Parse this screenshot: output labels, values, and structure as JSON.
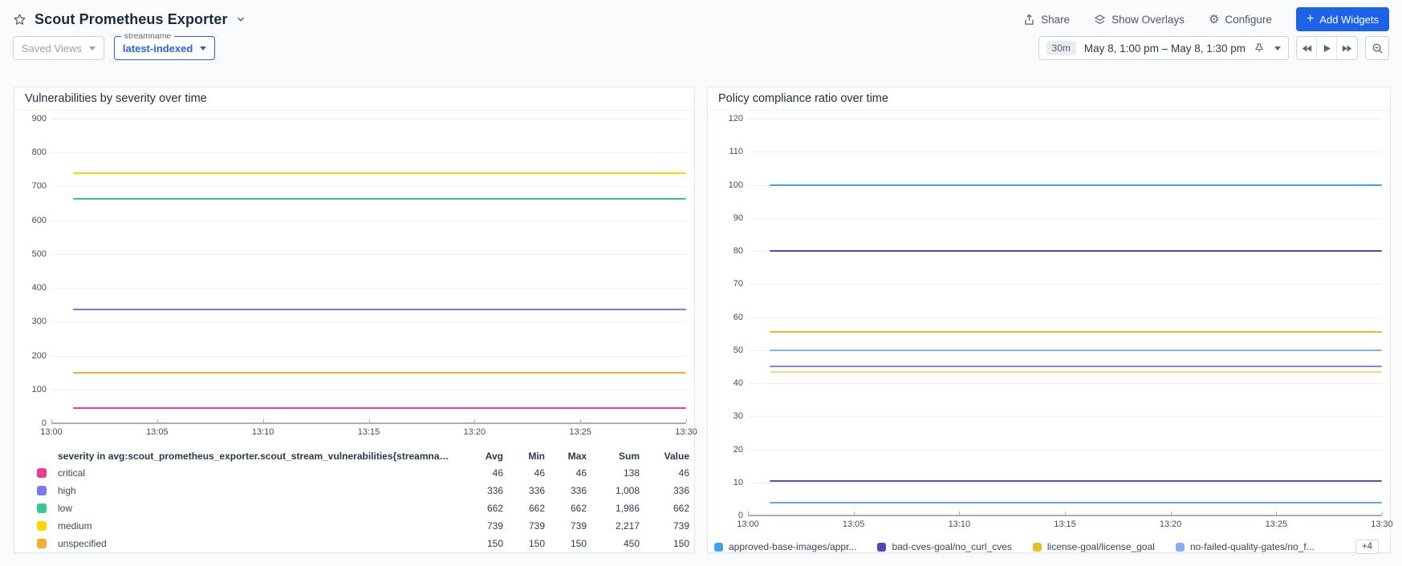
{
  "header": {
    "title": "Scout Prometheus Exporter",
    "share": "Share",
    "show_overlays": "Show Overlays",
    "configure": "Configure",
    "add_widgets": "Add Widgets",
    "accent_color": "#1d63ea"
  },
  "toolbar": {
    "saved_views": "Saved Views",
    "stream_label": "streamname",
    "stream_value": "latest-indexed",
    "duration_badge": "30m",
    "time_range": "May 8, 1:00 pm – May 8, 1:30 pm"
  },
  "chart_data": [
    {
      "type": "line",
      "title": "Vulnerabilities by severity over time",
      "x_ticks": [
        "13:00",
        "13:05",
        "13:10",
        "13:15",
        "13:20",
        "13:25",
        "13:30"
      ],
      "ylim": [
        0,
        900
      ],
      "ytick_step": 100,
      "grid": true,
      "legend_position": "bottom-table",
      "series": [
        {
          "name": "critical",
          "color": "#ee3d8b",
          "value": 46
        },
        {
          "name": "high",
          "color": "#7a77e9",
          "value": 336
        },
        {
          "name": "low",
          "color": "#33c79c",
          "value": 662
        },
        {
          "name": "medium",
          "color": "#ffd600",
          "value": 739
        },
        {
          "name": "unspecified",
          "color": "#f7ad33",
          "value": 150
        }
      ],
      "legend_table": {
        "header": "severity in avg:scout_prometheus_exporter.scout_stream_vulnerabilities{streamname:late...",
        "columns": [
          "Avg",
          "Min",
          "Max",
          "Sum",
          "Value"
        ],
        "rows": [
          {
            "label": "critical",
            "color": "#ee3d8b",
            "cells": [
              "46",
              "46",
              "46",
              "138",
              "46"
            ]
          },
          {
            "label": "high",
            "color": "#7a77e9",
            "cells": [
              "336",
              "336",
              "336",
              "1,008",
              "336"
            ]
          },
          {
            "label": "low",
            "color": "#33c79c",
            "cells": [
              "662",
              "662",
              "662",
              "1,986",
              "662"
            ]
          },
          {
            "label": "medium",
            "color": "#ffd600",
            "cells": [
              "739",
              "739",
              "739",
              "2,217",
              "739"
            ]
          },
          {
            "label": "unspecified",
            "color": "#f7ad33",
            "cells": [
              "150",
              "150",
              "150",
              "450",
              "150"
            ]
          }
        ]
      }
    },
    {
      "type": "line",
      "title": "Policy compliance ratio over time",
      "x_ticks": [
        "13:00",
        "13:05",
        "13:10",
        "13:15",
        "13:20",
        "13:25",
        "13:30"
      ],
      "ylim": [
        0,
        120
      ],
      "ytick_step": 10,
      "grid": true,
      "legend_position": "bottom-row",
      "legend_more": "+4",
      "series": [
        {
          "name": "approved-base-images/appr...",
          "color": "#3f9ff0",
          "value": 100,
          "in_legend": true
        },
        {
          "name": "bad-cves-goal/no_curl_cves",
          "color": "#5443bd",
          "value": 80,
          "in_legend": true
        },
        {
          "name": "license-goal/license_goal",
          "color": "#e9bd2a",
          "value": 55.5,
          "in_legend": true
        },
        {
          "name": "no-failed-quality-gates/no_f...",
          "color": "#8badf2",
          "value": 50,
          "in_legend": true
        },
        {
          "name": "",
          "color": "#8e7fe8",
          "value": 45,
          "in_legend": false
        },
        {
          "name": "",
          "color": "#f6d97d",
          "value": 43.5,
          "in_legend": false
        },
        {
          "name": "",
          "color": "#5c4bc6",
          "value": 10.4,
          "in_legend": false
        },
        {
          "name": "",
          "color": "#62a8f0",
          "value": 4,
          "in_legend": false
        }
      ]
    }
  ]
}
